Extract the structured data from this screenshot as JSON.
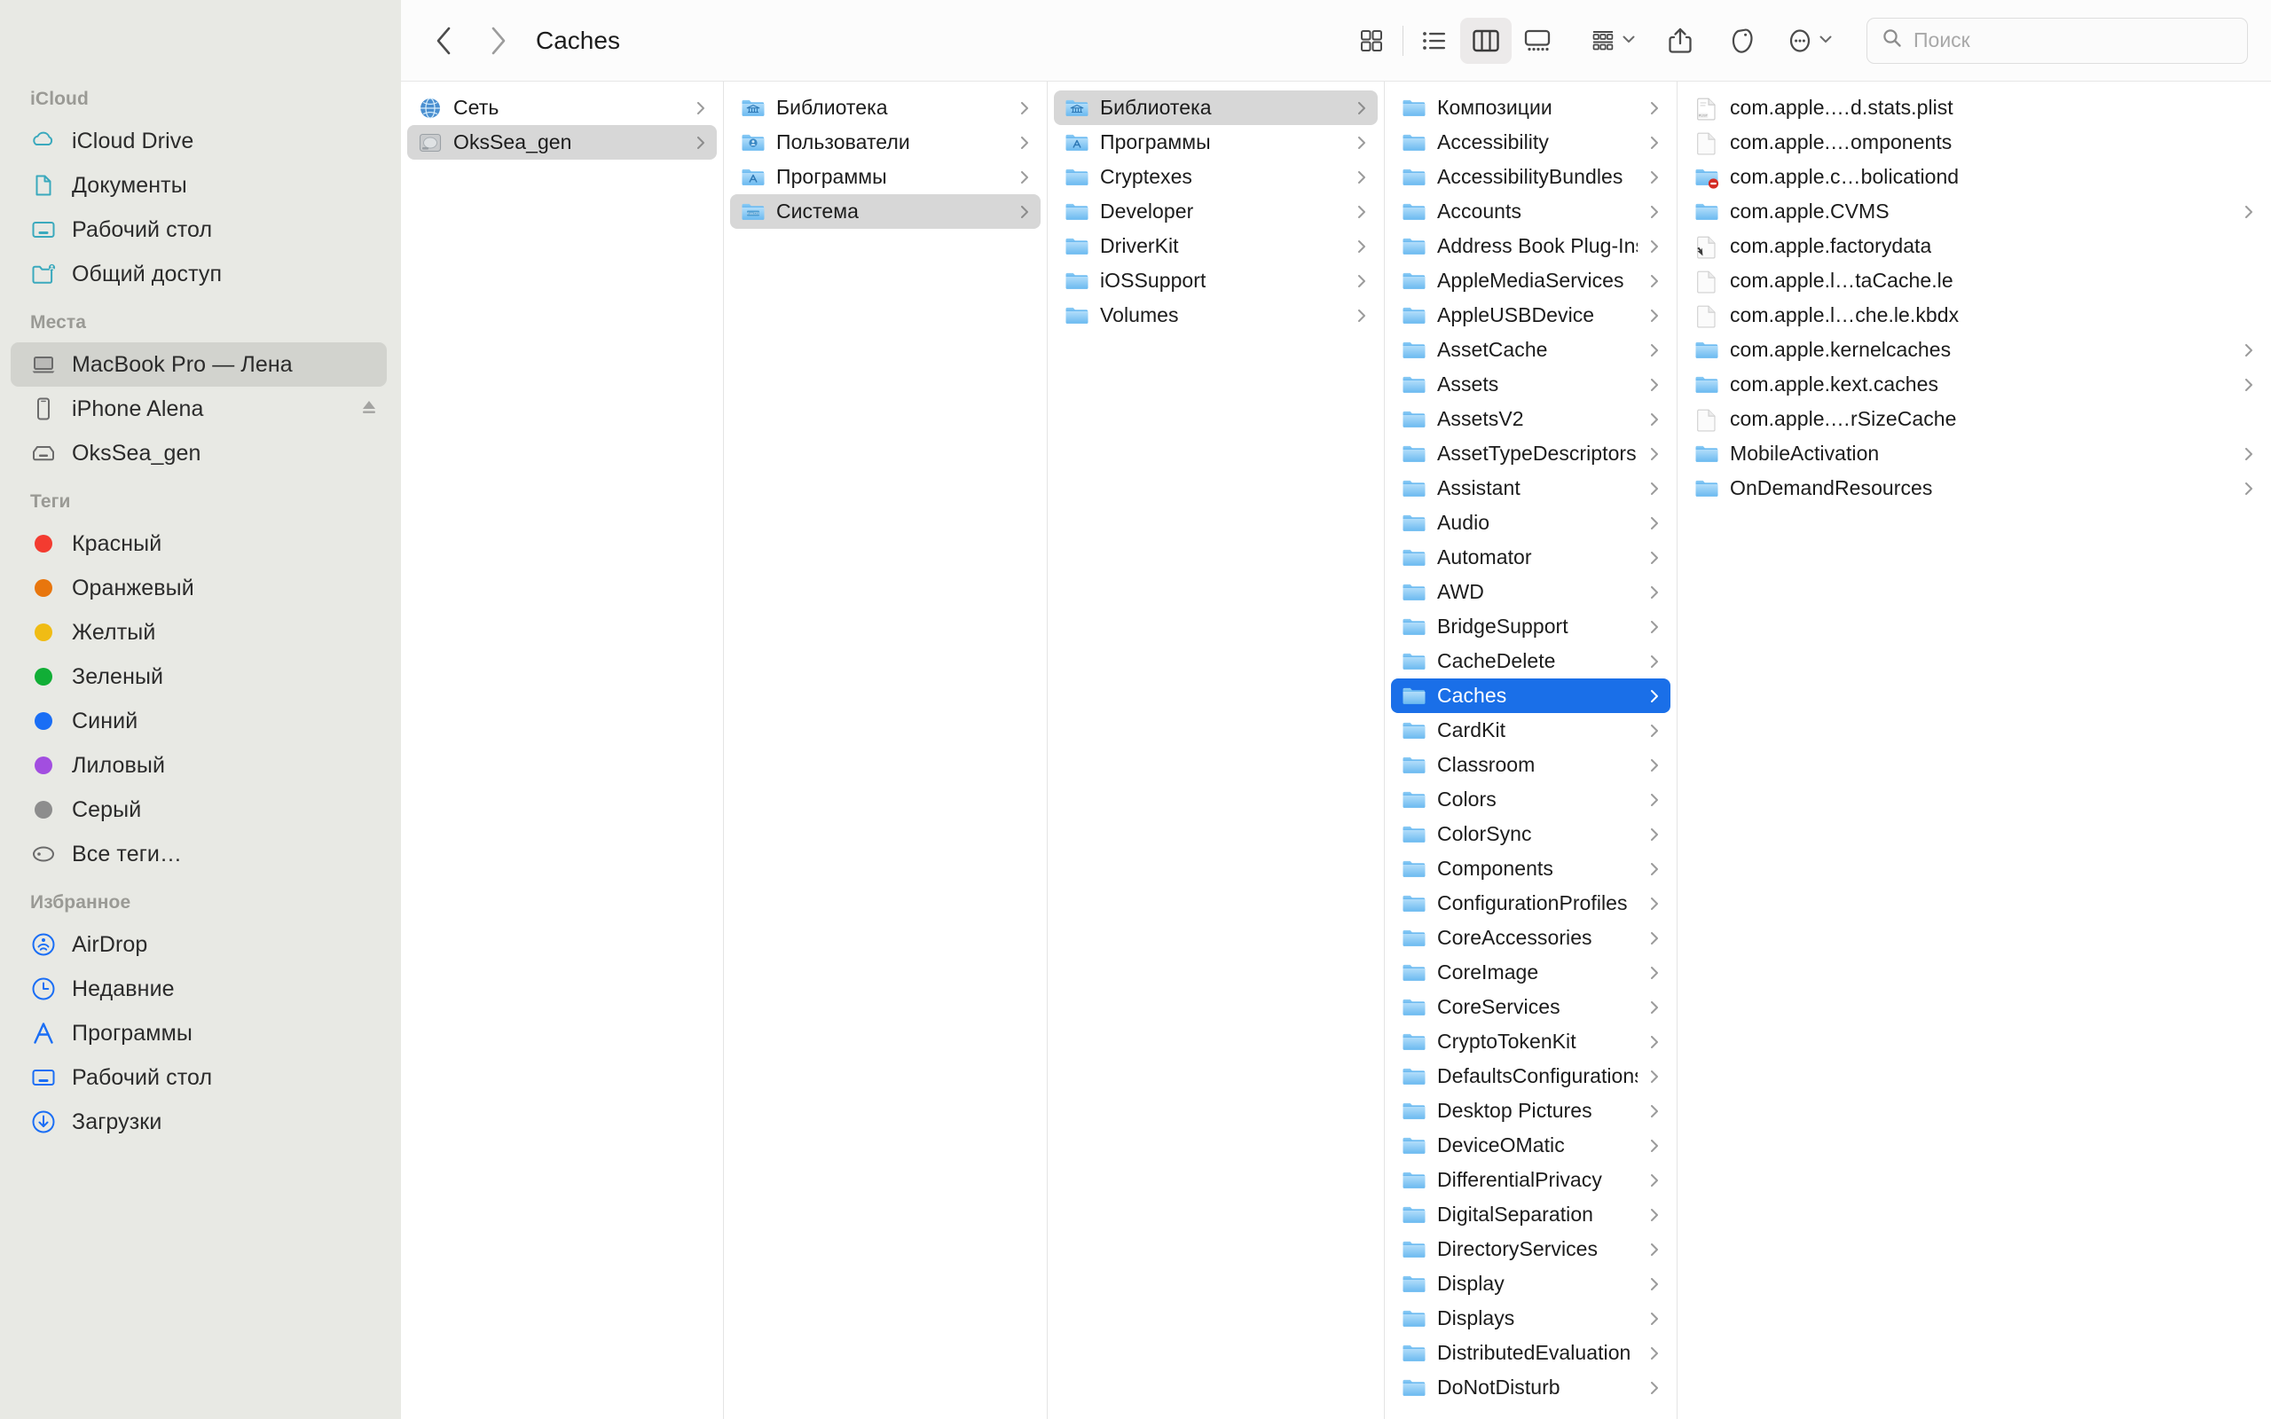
{
  "window": {
    "title": "Caches"
  },
  "toolbar": {
    "back_icon": "chevron-left-icon",
    "forward_icon": "chevron-right-icon",
    "views": [
      {
        "name": "icon-view",
        "icon": "grid-icon",
        "active": false
      },
      {
        "name": "list-view",
        "icon": "list-icon",
        "active": false
      },
      {
        "name": "column-view",
        "icon": "columns-icon",
        "active": true
      },
      {
        "name": "gallery-view",
        "icon": "gallery-icon",
        "active": false
      }
    ],
    "group_label": "group-by-button",
    "share_label": "share-button",
    "tag_label": "tag-button",
    "more_label": "more-actions-button"
  },
  "search": {
    "placeholder": "Поиск"
  },
  "sidebar": {
    "groups": [
      {
        "header": "iCloud",
        "items": [
          {
            "label": "iCloud Drive",
            "icon": "cloud-icon",
            "color": "#3aa9bd",
            "selected": false
          },
          {
            "label": "Документы",
            "icon": "document-icon",
            "color": "#3aa9bd",
            "selected": false
          },
          {
            "label": "Рабочий стол",
            "icon": "desktop-icon",
            "color": "#3aa9bd",
            "selected": false
          },
          {
            "label": "Общий доступ",
            "icon": "shared-folder-icon",
            "color": "#3aa9bd",
            "selected": false
          }
        ]
      },
      {
        "header": "Места",
        "items": [
          {
            "label": "MacBook Pro — Лена",
            "icon": "laptop-icon",
            "color": "#6b6b6b",
            "selected": true
          },
          {
            "label": "iPhone Alena",
            "icon": "iphone-icon",
            "color": "#6b6b6b",
            "selected": false,
            "eject": true
          },
          {
            "label": "OksSea_gen",
            "icon": "external-drive-icon",
            "color": "#6b6b6b",
            "selected": false
          }
        ]
      },
      {
        "header": "Теги",
        "items": [
          {
            "label": "Красный",
            "icon": "tag-dot-icon",
            "color": "#f33b30",
            "selected": false
          },
          {
            "label": "Оранжевый",
            "icon": "tag-dot-icon",
            "color": "#e8760d",
            "selected": false
          },
          {
            "label": "Желтый",
            "icon": "tag-dot-icon",
            "color": "#f0bc14",
            "selected": false
          },
          {
            "label": "Зеленый",
            "icon": "tag-dot-icon",
            "color": "#11ae36",
            "selected": false
          },
          {
            "label": "Синий",
            "icon": "tag-dot-icon",
            "color": "#1a6ef5",
            "selected": false
          },
          {
            "label": "Лиловый",
            "icon": "tag-dot-icon",
            "color": "#a24ee0",
            "selected": false
          },
          {
            "label": "Серый",
            "icon": "tag-dot-icon",
            "color": "#8d8d8d",
            "selected": false
          },
          {
            "label": "Все теги…",
            "icon": "all-tags-icon",
            "color": "#6b6b6b",
            "selected": false
          }
        ]
      },
      {
        "header": "Избранное",
        "items": [
          {
            "label": "AirDrop",
            "icon": "airdrop-icon",
            "color": "#1a6ef5",
            "selected": false
          },
          {
            "label": "Недавние",
            "icon": "clock-icon",
            "color": "#1a6ef5",
            "selected": false
          },
          {
            "label": "Программы",
            "icon": "applications-icon",
            "color": "#1a6ef5",
            "selected": false
          },
          {
            "label": "Рабочий стол",
            "icon": "desktop-icon",
            "color": "#1a6ef5",
            "selected": false
          },
          {
            "label": "Загрузки",
            "icon": "downloads-icon",
            "color": "#1a6ef5",
            "selected": false
          }
        ]
      }
    ]
  },
  "columns": [
    {
      "name": "column-devices",
      "items": [
        {
          "label": "Сеть",
          "icon": "network-globe-icon",
          "kind": "network",
          "chevron": true,
          "selected": false
        },
        {
          "label": "OksSea_gen",
          "icon": "hard-drive-icon",
          "kind": "drive",
          "chevron": true,
          "selected": "gray"
        }
      ]
    },
    {
      "name": "column-volume-root",
      "items": [
        {
          "label": "Библиотека",
          "icon": "library-folder-icon",
          "kind": "folder-library",
          "chevron": true,
          "selected": false
        },
        {
          "label": "Пользователи",
          "icon": "users-folder-icon",
          "kind": "folder-users",
          "chevron": true,
          "selected": false
        },
        {
          "label": "Программы",
          "icon": "applications-folder-icon",
          "kind": "folder-apps",
          "chevron": true,
          "selected": false
        },
        {
          "label": "Система",
          "icon": "system-folder-icon",
          "kind": "folder-system",
          "chevron": true,
          "selected": "gray"
        }
      ]
    },
    {
      "name": "column-system",
      "items": [
        {
          "label": "Библиотека",
          "icon": "library-folder-icon",
          "kind": "folder-library",
          "chevron": true,
          "selected": "gray"
        },
        {
          "label": "Программы",
          "icon": "applications-folder-icon",
          "kind": "folder-apps",
          "chevron": true,
          "selected": false
        },
        {
          "label": "Cryptexes",
          "icon": "folder-icon",
          "kind": "folder",
          "chevron": true,
          "selected": false
        },
        {
          "label": "Developer",
          "icon": "folder-icon",
          "kind": "folder",
          "chevron": true,
          "selected": false
        },
        {
          "label": "DriverKit",
          "icon": "folder-icon",
          "kind": "folder",
          "chevron": true,
          "selected": false
        },
        {
          "label": "iOSSupport",
          "icon": "folder-icon",
          "kind": "folder",
          "chevron": true,
          "selected": false
        },
        {
          "label": "Volumes",
          "icon": "folder-icon",
          "kind": "folder",
          "chevron": true,
          "selected": false
        }
      ]
    },
    {
      "name": "column-system-library",
      "items": [
        {
          "label": "Композиции",
          "icon": "folder-icon",
          "kind": "folder",
          "chevron": true,
          "selected": false
        },
        {
          "label": "Accessibility",
          "icon": "folder-icon",
          "kind": "folder",
          "chevron": true,
          "selected": false
        },
        {
          "label": "AccessibilityBundles",
          "icon": "folder-icon",
          "kind": "folder",
          "chevron": true,
          "selected": false
        },
        {
          "label": "Accounts",
          "icon": "folder-icon",
          "kind": "folder",
          "chevron": true,
          "selected": false
        },
        {
          "label": "Address Book Plug-Ins",
          "icon": "folder-icon",
          "kind": "folder",
          "chevron": true,
          "selected": false
        },
        {
          "label": "AppleMediaServices",
          "icon": "folder-icon",
          "kind": "folder",
          "chevron": true,
          "selected": false
        },
        {
          "label": "AppleUSBDevice",
          "icon": "folder-icon",
          "kind": "folder",
          "chevron": true,
          "selected": false
        },
        {
          "label": "AssetCache",
          "icon": "folder-icon",
          "kind": "folder",
          "chevron": true,
          "selected": false
        },
        {
          "label": "Assets",
          "icon": "folder-icon",
          "kind": "folder",
          "chevron": true,
          "selected": false
        },
        {
          "label": "AssetsV2",
          "icon": "folder-icon",
          "kind": "folder",
          "chevron": true,
          "selected": false
        },
        {
          "label": "AssetTypeDescriptors",
          "icon": "folder-icon",
          "kind": "folder",
          "chevron": true,
          "selected": false
        },
        {
          "label": "Assistant",
          "icon": "folder-icon",
          "kind": "folder",
          "chevron": true,
          "selected": false
        },
        {
          "label": "Audio",
          "icon": "folder-icon",
          "kind": "folder",
          "chevron": true,
          "selected": false
        },
        {
          "label": "Automator",
          "icon": "folder-icon",
          "kind": "folder",
          "chevron": true,
          "selected": false
        },
        {
          "label": "AWD",
          "icon": "folder-icon",
          "kind": "folder",
          "chevron": true,
          "selected": false
        },
        {
          "label": "BridgeSupport",
          "icon": "folder-icon",
          "kind": "folder",
          "chevron": true,
          "selected": false
        },
        {
          "label": "CacheDelete",
          "icon": "folder-icon",
          "kind": "folder",
          "chevron": true,
          "selected": false
        },
        {
          "label": "Caches",
          "icon": "folder-icon",
          "kind": "folder",
          "chevron": true,
          "selected": "blue"
        },
        {
          "label": "CardKit",
          "icon": "folder-icon",
          "kind": "folder",
          "chevron": true,
          "selected": false
        },
        {
          "label": "Classroom",
          "icon": "folder-icon",
          "kind": "folder",
          "chevron": true,
          "selected": false
        },
        {
          "label": "Colors",
          "icon": "folder-icon",
          "kind": "folder",
          "chevron": true,
          "selected": false
        },
        {
          "label": "ColorSync",
          "icon": "folder-icon",
          "kind": "folder",
          "chevron": true,
          "selected": false
        },
        {
          "label": "Components",
          "icon": "folder-icon",
          "kind": "folder",
          "chevron": true,
          "selected": false
        },
        {
          "label": "ConfigurationProfiles",
          "icon": "folder-icon",
          "kind": "folder",
          "chevron": true,
          "selected": false
        },
        {
          "label": "CoreAccessories",
          "icon": "folder-icon",
          "kind": "folder",
          "chevron": true,
          "selected": false
        },
        {
          "label": "CoreImage",
          "icon": "folder-icon",
          "kind": "folder",
          "chevron": true,
          "selected": false
        },
        {
          "label": "CoreServices",
          "icon": "folder-icon",
          "kind": "folder",
          "chevron": true,
          "selected": false
        },
        {
          "label": "CryptoTokenKit",
          "icon": "folder-icon",
          "kind": "folder",
          "chevron": true,
          "selected": false
        },
        {
          "label": "DefaultsConfigurations",
          "icon": "folder-icon",
          "kind": "folder",
          "chevron": true,
          "selected": false
        },
        {
          "label": "Desktop Pictures",
          "icon": "folder-icon",
          "kind": "folder",
          "chevron": true,
          "selected": false
        },
        {
          "label": "DeviceOMatic",
          "icon": "folder-icon",
          "kind": "folder",
          "chevron": true,
          "selected": false
        },
        {
          "label": "DifferentialPrivacy",
          "icon": "folder-icon",
          "kind": "folder",
          "chevron": true,
          "selected": false
        },
        {
          "label": "DigitalSeparation",
          "icon": "folder-icon",
          "kind": "folder",
          "chevron": true,
          "selected": false
        },
        {
          "label": "DirectoryServices",
          "icon": "folder-icon",
          "kind": "folder",
          "chevron": true,
          "selected": false
        },
        {
          "label": "Display",
          "icon": "folder-icon",
          "kind": "folder",
          "chevron": true,
          "selected": false
        },
        {
          "label": "Displays",
          "icon": "folder-icon",
          "kind": "folder",
          "chevron": true,
          "selected": false
        },
        {
          "label": "DistributedEvaluation",
          "icon": "folder-icon",
          "kind": "folder",
          "chevron": true,
          "selected": false
        },
        {
          "label": "DoNotDisturb",
          "icon": "folder-icon",
          "kind": "folder",
          "chevron": true,
          "selected": false
        }
      ]
    },
    {
      "name": "column-caches",
      "items": [
        {
          "label": "com.apple.…d.stats.plist",
          "icon": "plist-file-icon",
          "kind": "file-plist",
          "chevron": false,
          "selected": false
        },
        {
          "label": "com.apple.…omponents",
          "icon": "generic-file-icon",
          "kind": "file",
          "chevron": false,
          "selected": false
        },
        {
          "label": "com.apple.c…bolicationd",
          "icon": "folder-restricted-icon",
          "kind": "folder-restricted",
          "chevron": false,
          "selected": false
        },
        {
          "label": "com.apple.CVMS",
          "icon": "folder-icon",
          "kind": "folder",
          "chevron": true,
          "selected": false
        },
        {
          "label": "com.apple.factorydata",
          "icon": "alias-file-icon",
          "kind": "file-alias",
          "chevron": false,
          "selected": false
        },
        {
          "label": "com.apple.l…taCache.le",
          "icon": "generic-file-icon",
          "kind": "file",
          "chevron": false,
          "selected": false
        },
        {
          "label": "com.apple.l…che.le.kbdx",
          "icon": "generic-file-icon",
          "kind": "file",
          "chevron": false,
          "selected": false
        },
        {
          "label": "com.apple.kernelcaches",
          "icon": "folder-icon",
          "kind": "folder",
          "chevron": true,
          "selected": false
        },
        {
          "label": "com.apple.kext.caches",
          "icon": "folder-icon",
          "kind": "folder",
          "chevron": true,
          "selected": false
        },
        {
          "label": "com.apple.…rSizeCache",
          "icon": "generic-file-icon",
          "kind": "file",
          "chevron": false,
          "selected": false
        },
        {
          "label": "MobileActivation",
          "icon": "folder-icon",
          "kind": "folder",
          "chevron": true,
          "selected": false
        },
        {
          "label": "OnDemandResources",
          "icon": "folder-icon",
          "kind": "folder",
          "chevron": true,
          "selected": false
        }
      ]
    }
  ]
}
